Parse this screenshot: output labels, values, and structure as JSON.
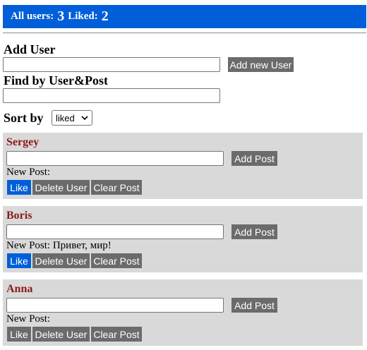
{
  "header": {
    "all_users_label": "All users:",
    "all_users_count": "3",
    "liked_label": "Liked:",
    "liked_count": "2"
  },
  "add_user": {
    "title": "Add User",
    "input_value": "",
    "button_label": "Add new User"
  },
  "find": {
    "title": "Find by User&Post",
    "input_value": ""
  },
  "sort": {
    "label": "Sort by",
    "selected": "liked"
  },
  "users": [
    {
      "name": "Sergey",
      "post_input": "",
      "add_post_label": "Add Post",
      "new_post_label": "New Post:",
      "new_post_text": "",
      "like_label": "Like",
      "delete_label": "Delete User",
      "clear_label": "Clear Post",
      "liked": true
    },
    {
      "name": "Boris",
      "post_input": "",
      "add_post_label": "Add Post",
      "new_post_label": "New Post:",
      "new_post_text": "Привет, мир!",
      "like_label": "Like",
      "delete_label": "Delete User",
      "clear_label": "Clear Post",
      "liked": true
    },
    {
      "name": "Anna",
      "post_input": "",
      "add_post_label": "Add Post",
      "new_post_label": "New Post:",
      "new_post_text": "",
      "like_label": "Like",
      "delete_label": "Delete User",
      "clear_label": "Clear Post",
      "liked": false
    }
  ],
  "colors": {
    "accent": "#005fd8",
    "button": "#6b6b6b",
    "card": "#d9d9d9",
    "name": "#8b1a1a"
  },
  "icons": {
    "select_arrow": "chevron-down-icon"
  }
}
